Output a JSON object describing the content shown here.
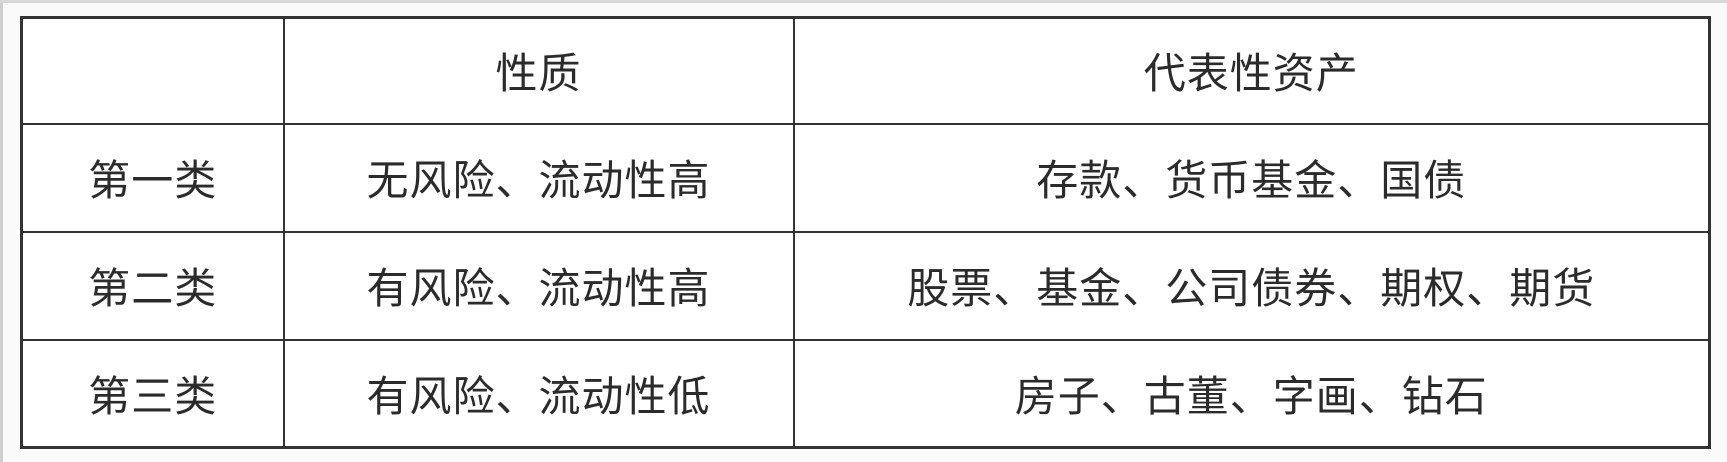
{
  "table": {
    "headers": [
      "",
      "性质",
      "代表性资产"
    ],
    "rows": [
      [
        "第一类",
        "无风险、流动性高",
        "存款、货币基金、国债"
      ],
      [
        "第二类",
        "有风险、流动性高",
        "股票、基金、公司债券、期权、期货"
      ],
      [
        "第三类",
        "有风险、流动性低",
        "房子、古董、字画、钻石"
      ]
    ]
  }
}
